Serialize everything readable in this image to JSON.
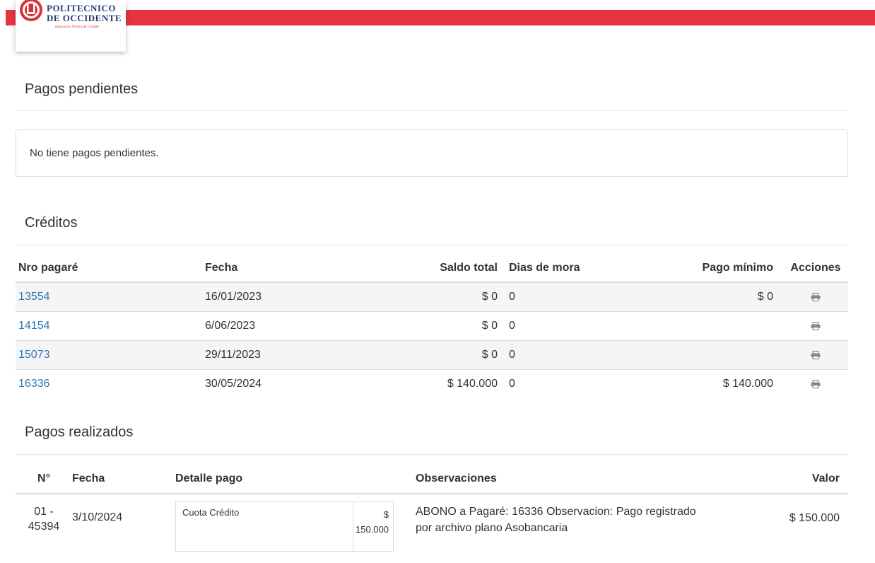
{
  "brand": {
    "line1": "POLITECNICO",
    "line2": "DE OCCIDENTE",
    "tagline": "Educación Técnica de Calidad",
    "accent_color": "#e5333f"
  },
  "pendientes": {
    "title": "Pagos pendientes",
    "message": "No tiene pagos pendientes."
  },
  "creditos": {
    "title": "Créditos",
    "headers": {
      "nro": "Nro pagaré",
      "fecha": "Fecha",
      "saldo": "Saldo total",
      "mora": "Dias de mora",
      "minimo": "Pago mínimo",
      "acciones": "Acciones"
    },
    "rows": [
      {
        "nro": "13554",
        "fecha": "16/01/2023",
        "saldo": "$ 0",
        "mora": "0",
        "minimo": "$ 0",
        "icon": "printer-icon"
      },
      {
        "nro": "14154",
        "fecha": "6/06/2023",
        "saldo": "$ 0",
        "mora": "0",
        "minimo": "",
        "icon": "printer-icon"
      },
      {
        "nro": "15073",
        "fecha": "29/11/2023",
        "saldo": "$ 0",
        "mora": "0",
        "minimo": "",
        "icon": "printer-icon"
      },
      {
        "nro": "16336",
        "fecha": "30/05/2024",
        "saldo": "$ 140.000",
        "mora": "0",
        "minimo": "$ 140.000",
        "icon": "printer-icon"
      }
    ]
  },
  "realizados": {
    "title": "Pagos realizados",
    "headers": {
      "num": "N°",
      "fecha": "Fecha",
      "detalle": "Detalle pago",
      "obs": "Observaciones",
      "valor": "Valor"
    },
    "rows": [
      {
        "num_line1": "01 -",
        "num_line2": "45394",
        "fecha": "3/10/2024",
        "detalle_concepto": "Cuota Crédito",
        "detalle_moneda": "$",
        "detalle_valor": "150.000",
        "obs_line1": "ABONO a Pagaré: 16336 Observacion: Pago registrado",
        "obs_line2": "por archivo plano Asobancaria",
        "valor": "$ 150.000"
      }
    ]
  }
}
